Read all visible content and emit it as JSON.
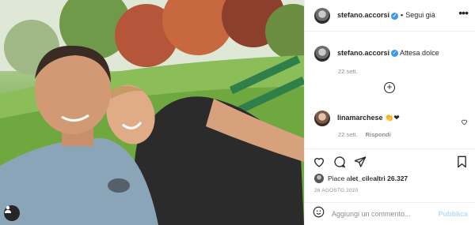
{
  "header": {
    "username": "stefano.accorsi",
    "separator": "•",
    "follow_label": "Segui già",
    "more_label": "•••"
  },
  "caption": {
    "username": "stefano.accorsi",
    "text": "Attesa dolce",
    "date": "22 sett."
  },
  "load_more_label": "+",
  "comments": [
    {
      "username": "linamarchese",
      "emoji": "👏❤",
      "date": "22 sett.",
      "reply_label": "Rispondi"
    }
  ],
  "likes": {
    "prefix": "Piace a ",
    "user": "let_cil",
    "suffix": " e ",
    "others": "altri 26.327"
  },
  "post_date": "26 AGOSTO 2020",
  "add_comment": {
    "placeholder": "Aggiungi un commento...",
    "publish_label": "Pubblica"
  },
  "icons": [
    "more-icon",
    "verified-icon",
    "plus-circle-icon",
    "heart-icon",
    "comment-icon",
    "share-icon",
    "bookmark-icon",
    "emoji-icon",
    "user-tag-icon"
  ],
  "colors": {
    "link_blue": "#3897f0",
    "publish_disabled": "#b3dbff",
    "muted": "#8e8e8e"
  }
}
